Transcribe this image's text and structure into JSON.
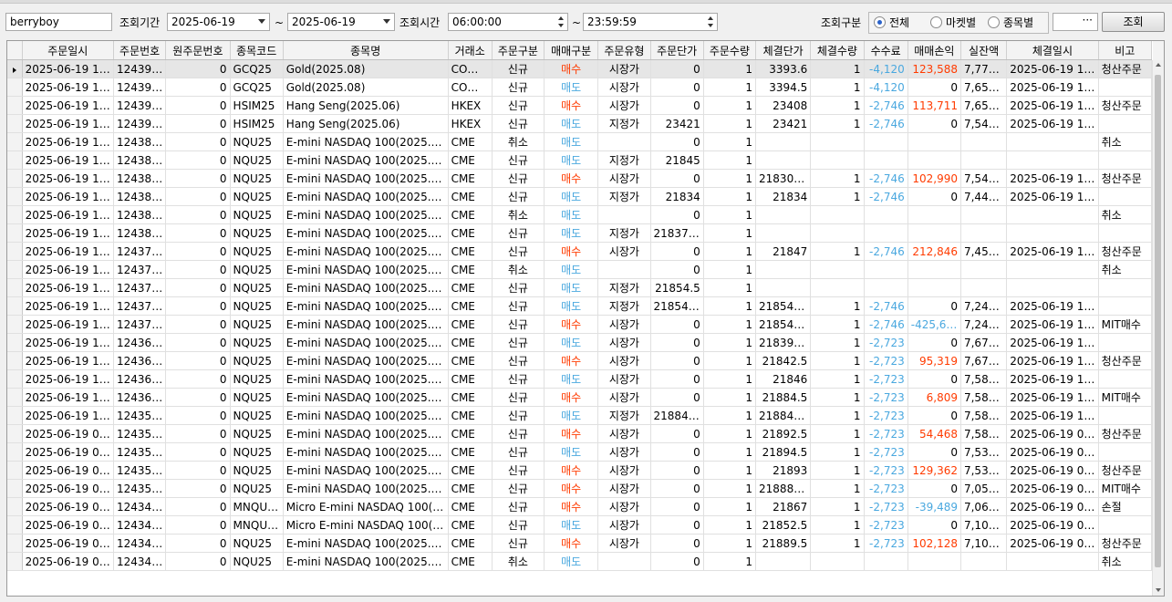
{
  "toolbar": {
    "user": "berryboy",
    "period_label": "조회기간",
    "date_from": "2025-06-19",
    "tilde": "~",
    "date_to": "2025-06-19",
    "time_label": "조회시간",
    "time_from": "06:00:00",
    "time_to": "23:59:59",
    "type_label": "조회구분",
    "radio_all": "전체",
    "radio_market": "마켓별",
    "radio_item": "종목별",
    "selected": "전체",
    "ellipsis": "···",
    "search_button": "조회"
  },
  "colors": {
    "buy": "#ff3b00",
    "sell": "#4aa8df"
  },
  "table": {
    "headers": [
      "주문일시",
      "주문번호",
      "원주문번호",
      "종목코드",
      "종목명",
      "거래소",
      "주문구분",
      "매매구분",
      "주문유형",
      "주문단가",
      "주문수량",
      "체결단가",
      "체결수량",
      "수수료",
      "매매손익",
      "실잔액",
      "체결일시",
      "비고"
    ],
    "rows": [
      [
        "2025-06-19 11:…",
        "1243991",
        "0",
        "GCQ25",
        "Gold(2025.08)",
        "CO…",
        "신규",
        "매수",
        "시장가",
        "0",
        "1",
        "3393.6",
        "1",
        "-4,120",
        "123,588",
        "7,772…",
        "2025-06-19 11:…",
        "청산주문"
      ],
      [
        "2025-06-19 11:…",
        "1243981",
        "0",
        "GCQ25",
        "Gold(2025.08)",
        "CO…",
        "신규",
        "매도",
        "시장가",
        "0",
        "1",
        "3394.5",
        "1",
        "-4,120",
        "0",
        "7,653…",
        "2025-06-19 11:…",
        ""
      ],
      [
        "2025-06-19 11:…",
        "1243961",
        "0",
        "HSIM25",
        "Hang Seng(2025.06)",
        "HKEX",
        "신규",
        "매수",
        "시장가",
        "0",
        "1",
        "23408",
        "1",
        "-2,746",
        "113,711",
        "7,657…",
        "2025-06-19 11:…",
        "청산주문"
      ],
      [
        "2025-06-19 11:…",
        "1243957",
        "0",
        "HSIM25",
        "Hang Seng(2025.06)",
        "HKEX",
        "신규",
        "매도",
        "지정가",
        "23421",
        "1",
        "23421",
        "1",
        "-2,746",
        "0",
        "7,546…",
        "2025-06-19 11:…",
        ""
      ],
      [
        "2025-06-19 11:…",
        "1243855",
        "0",
        "NQU25",
        "E-mini NASDAQ 100(2025.09)",
        "CME",
        "취소",
        "매도",
        "",
        "0",
        "1",
        "",
        "",
        "",
        "",
        "",
        "",
        "취소"
      ],
      [
        "2025-06-19 11:…",
        "1243855",
        "0",
        "NQU25",
        "E-mini NASDAQ 100(2025.09)",
        "CME",
        "신규",
        "매도",
        "지정가",
        "21845",
        "1",
        "",
        "",
        "",
        "",
        "",
        "",
        ""
      ],
      [
        "2025-06-19 11:…",
        "1243843",
        "0",
        "NQU25",
        "E-mini NASDAQ 100(2025.09)",
        "CME",
        "신규",
        "매수",
        "시장가",
        "0",
        "1",
        "21830.25",
        "1",
        "-2,746",
        "102,990",
        "7,549…",
        "2025-06-19 11:…",
        "청산주문"
      ],
      [
        "2025-06-19 11:…",
        "1243841",
        "0",
        "NQU25",
        "E-mini NASDAQ 100(2025.09)",
        "CME",
        "신규",
        "매도",
        "지정가",
        "21834",
        "1",
        "21834",
        "1",
        "-2,746",
        "0",
        "7,448…",
        "2025-06-19 11:…",
        ""
      ],
      [
        "2025-06-19 11:…",
        "1243840",
        "0",
        "NQU25",
        "E-mini NASDAQ 100(2025.09)",
        "CME",
        "취소",
        "매도",
        "",
        "0",
        "1",
        "",
        "",
        "",
        "",
        "",
        "",
        "취소"
      ],
      [
        "2025-06-19 11:…",
        "1243840",
        "0",
        "NQU25",
        "E-mini NASDAQ 100(2025.09)",
        "CME",
        "신규",
        "매도",
        "지정가",
        "21837.75",
        "1",
        "",
        "",
        "",
        "",
        "",
        "",
        ""
      ],
      [
        "2025-06-19 10:…",
        "1243753",
        "0",
        "NQU25",
        "E-mini NASDAQ 100(2025.09)",
        "CME",
        "신규",
        "매수",
        "시장가",
        "0",
        "1",
        "21847",
        "1",
        "-2,746",
        "212,846",
        "7,451…",
        "2025-06-19 10:…",
        "청산주문"
      ],
      [
        "2025-06-19 10:…",
        "1243723",
        "0",
        "NQU25",
        "E-mini NASDAQ 100(2025.09)",
        "CME",
        "취소",
        "매도",
        "",
        "0",
        "1",
        "",
        "",
        "",
        "",
        "",
        "",
        "취소"
      ],
      [
        "2025-06-19 10:…",
        "1243723",
        "0",
        "NQU25",
        "E-mini NASDAQ 100(2025.09)",
        "CME",
        "신규",
        "매도",
        "지정가",
        "21854.5",
        "1",
        "",
        "",
        "",
        "",
        "",
        "",
        ""
      ],
      [
        "2025-06-19 10:…",
        "1243722",
        "0",
        "NQU25",
        "E-mini NASDAQ 100(2025.09)",
        "CME",
        "신규",
        "매도",
        "지정가",
        "21854.75",
        "1",
        "21854.75",
        "1",
        "-2,746",
        "0",
        "7,241…",
        "2025-06-19 10:…",
        ""
      ],
      [
        "2025-06-19 10:…",
        "1243716",
        "0",
        "NQU25",
        "E-mini NASDAQ 100(2025.09)",
        "CME",
        "신규",
        "매수",
        "시장가",
        "0",
        "1",
        "21854.75",
        "1",
        "-2,746",
        "-425,692",
        "7,244…",
        "2025-06-19 10:…",
        "MIT매수"
      ],
      [
        "2025-06-19 10:…",
        "1243695",
        "0",
        "NQU25",
        "E-mini NASDAQ 100(2025.09)",
        "CME",
        "신규",
        "매도",
        "시장가",
        "0",
        "1",
        "21839.25",
        "1",
        "-2,723",
        "0",
        "7,672…",
        "2025-06-19 10:…",
        ""
      ],
      [
        "2025-06-19 10:…",
        "1243666",
        "0",
        "NQU25",
        "E-mini NASDAQ 100(2025.09)",
        "CME",
        "신규",
        "매수",
        "시장가",
        "0",
        "1",
        "21842.5",
        "1",
        "-2,723",
        "95,319",
        "7,675…",
        "2025-06-19 10:…",
        "청산주문"
      ],
      [
        "2025-06-19 10:…",
        "1243665",
        "0",
        "NQU25",
        "E-mini NASDAQ 100(2025.09)",
        "CME",
        "신규",
        "매도",
        "시장가",
        "0",
        "1",
        "21846",
        "1",
        "-2,723",
        "0",
        "7,582…",
        "2025-06-19 10:…",
        ""
      ],
      [
        "2025-06-19 10:…",
        "1243663",
        "0",
        "NQU25",
        "E-mini NASDAQ 100(2025.09)",
        "CME",
        "신규",
        "매수",
        "시장가",
        "0",
        "1",
        "21884.5",
        "1",
        "-2,723",
        "6,809",
        "7,585…",
        "2025-06-19 10:…",
        "MIT매수"
      ],
      [
        "2025-06-19 10:…",
        "1243557",
        "0",
        "NQU25",
        "E-mini NASDAQ 100(2025.09)",
        "CME",
        "신규",
        "매도",
        "지정가",
        "21884.75",
        "1",
        "21884.75",
        "1",
        "-2,723",
        "0",
        "7,581…",
        "2025-06-19 10:…",
        ""
      ],
      [
        "2025-06-19 09:…",
        "1243553",
        "0",
        "NQU25",
        "E-mini NASDAQ 100(2025.09)",
        "CME",
        "신규",
        "매수",
        "시장가",
        "0",
        "1",
        "21892.5",
        "1",
        "-2,723",
        "54,468",
        "7,584…",
        "2025-06-19 09:…",
        "청산주문"
      ],
      [
        "2025-06-19 09:…",
        "1243541",
        "0",
        "NQU25",
        "E-mini NASDAQ 100(2025.09)",
        "CME",
        "신규",
        "매도",
        "시장가",
        "0",
        "1",
        "21894.5",
        "1",
        "-2,723",
        "0",
        "7,532…",
        "2025-06-19 09:…",
        ""
      ],
      [
        "2025-06-19 09:…",
        "1243529",
        "0",
        "NQU25",
        "E-mini NASDAQ 100(2025.09)",
        "CME",
        "신규",
        "매수",
        "시장가",
        "0",
        "1",
        "21893",
        "1",
        "-2,723",
        "129,362",
        "7,535…",
        "2025-06-19 09:…",
        "청산주문"
      ],
      [
        "2025-06-19 09:…",
        "1243524",
        "0",
        "NQU25",
        "E-mini NASDAQ 100(2025.09)",
        "CME",
        "신규",
        "매수",
        "시장가",
        "0",
        "1",
        "21888.25",
        "1",
        "-2,723",
        "0",
        "7,058…",
        "2025-06-19 09:…",
        "MIT매수"
      ],
      [
        "2025-06-19 09:…",
        "1243456",
        "0",
        "MNQU25",
        "Micro E-mini NASDAQ 100(…",
        "CME",
        "신규",
        "매수",
        "시장가",
        "0",
        "1",
        "21867",
        "1",
        "-2,723",
        "-39,489",
        "7,061…",
        "2025-06-19 09:…",
        "손절"
      ],
      [
        "2025-06-19 09:…",
        "1243451",
        "0",
        "MNQU25",
        "Micro E-mini NASDAQ 100(…",
        "CME",
        "신규",
        "매도",
        "시장가",
        "0",
        "1",
        "21852.5",
        "1",
        "-2,723",
        "0",
        "7,103…",
        "2025-06-19 09:…",
        ""
      ],
      [
        "2025-06-19 09:…",
        "1243448",
        "0",
        "NQU25",
        "E-mini NASDAQ 100(2025.09)",
        "CME",
        "신규",
        "매수",
        "시장가",
        "0",
        "1",
        "21889.5",
        "1",
        "-2,723",
        "102,128",
        "7,106…",
        "2025-06-19 09:…",
        "청산주문"
      ],
      [
        "2025-06-19 09:…",
        "1243445",
        "0",
        "NQU25",
        "E-mini NASDAQ 100(2025.09)",
        "CME",
        "취소",
        "매도",
        "",
        "0",
        "1",
        "",
        "",
        "",
        "",
        "",
        "",
        "취소"
      ]
    ]
  }
}
